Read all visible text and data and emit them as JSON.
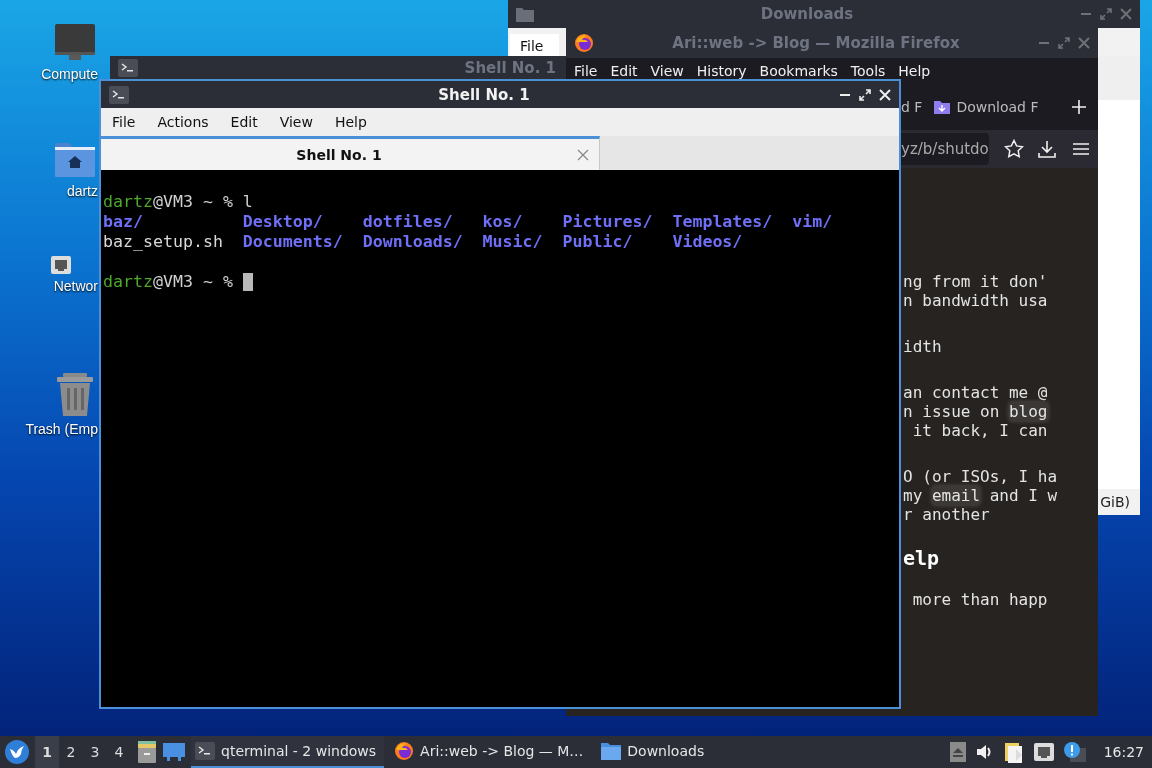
{
  "desktop_icons": [
    {
      "label": "Compute",
      "kind": "computer"
    },
    {
      "label": "dartz",
      "kind": "home"
    },
    {
      "label": "Networ",
      "kind": "network"
    },
    {
      "label": "Trash (Emp",
      "kind": "trash"
    }
  ],
  "downloads_window": {
    "title": "Downloads",
    "active": false,
    "menu": [
      "File"
    ],
    "status": "GiB)"
  },
  "background_terminal": {
    "title": "Shell No. 1",
    "active": false
  },
  "firefox_window": {
    "title": "Ari::web -> Blog — Mozilla Firefox",
    "active": false,
    "menu": [
      "File",
      "Edit",
      "View",
      "History",
      "Bookmarks",
      "Tools",
      "Help"
    ],
    "tabs": [
      {
        "label": "d F",
        "kind": "plain"
      },
      {
        "label": "Download F",
        "kind": "download"
      }
    ],
    "url": "yz/b/shutdo",
    "content": [
      {
        "kind": "paragraph",
        "lines": [
          [
            {
              "text": "ng from it don'",
              "code": false
            }
          ],
          [
            {
              "text": "n bandwidth usa",
              "code": false
            }
          ]
        ]
      },
      {
        "kind": "paragraph",
        "lines": [
          [
            {
              "text": "idth",
              "code": false
            }
          ]
        ]
      },
      {
        "kind": "paragraph",
        "lines": [
          [
            {
              "text": "an contact me @",
              "code": false
            }
          ],
          [
            {
              "text": "n issue on ",
              "code": false
            },
            {
              "text": "blog",
              "code": true
            }
          ],
          [
            {
              "text": " it back, I can",
              "code": false
            }
          ]
        ]
      },
      {
        "kind": "paragraph",
        "lines": [
          [
            {
              "text": "O (or ISOs, I ha",
              "code": false
            }
          ],
          [
            {
              "text": "my ",
              "code": false
            },
            {
              "text": "email",
              "code": true
            },
            {
              "text": " and I w",
              "code": false
            }
          ],
          [
            {
              "text": "r another",
              "code": false
            }
          ]
        ]
      },
      {
        "kind": "heading",
        "lines": [
          [
            {
              "text": "elp",
              "code": false
            }
          ]
        ]
      },
      {
        "kind": "paragraph",
        "lines": [
          [
            {
              "text": " more than happ",
              "code": false
            }
          ]
        ]
      }
    ]
  },
  "terminal_window": {
    "title": "Shell No. 1",
    "active": true,
    "menu": [
      "File",
      "Actions",
      "Edit",
      "View",
      "Help"
    ],
    "tabs": [
      {
        "label": "Shell No. 1",
        "selected": true
      }
    ],
    "lines": [
      {
        "kind": "prompt",
        "user": "dartz",
        "host": "@VM3 ~ % ",
        "command": "l",
        "cursor": false
      },
      {
        "kind": "listing",
        "rows": [
          [
            {
              "name": "baz/",
              "kind": "dir"
            },
            {
              "name": "Desktop/",
              "kind": "dir"
            },
            {
              "name": "dotfiles/",
              "kind": "dir"
            },
            {
              "name": "kos/",
              "kind": "dir"
            },
            {
              "name": "Pictures/",
              "kind": "dir"
            },
            {
              "name": "Templates/",
              "kind": "dir"
            },
            {
              "name": "vim/",
              "kind": "dir"
            }
          ],
          [
            {
              "name": "baz_setup.sh",
              "kind": "file"
            },
            {
              "name": "Documents/",
              "kind": "dir"
            },
            {
              "name": "Downloads/",
              "kind": "dir"
            },
            {
              "name": "Music/",
              "kind": "dir"
            },
            {
              "name": "Public/",
              "kind": "dir"
            },
            {
              "name": "Videos/",
              "kind": "dir"
            }
          ]
        ]
      },
      {
        "kind": "blank"
      },
      {
        "kind": "prompt",
        "user": "dartz",
        "host": "@VM3 ~ % ",
        "cursor": true
      }
    ]
  },
  "taskbar": {
    "workspaces": [
      {
        "label": "1",
        "selected": true
      },
      {
        "label": "2",
        "selected": false
      },
      {
        "label": "3",
        "selected": false
      },
      {
        "label": "4",
        "selected": false
      }
    ],
    "tasks": [
      {
        "label": "qterminal - 2 windows",
        "kind": "terminal",
        "selected": true
      },
      {
        "label": "Ari::web -> Blog — M…",
        "kind": "browser",
        "selected": false
      },
      {
        "label": "Downloads",
        "kind": "folder",
        "selected": false
      }
    ],
    "clock": "16:27"
  }
}
